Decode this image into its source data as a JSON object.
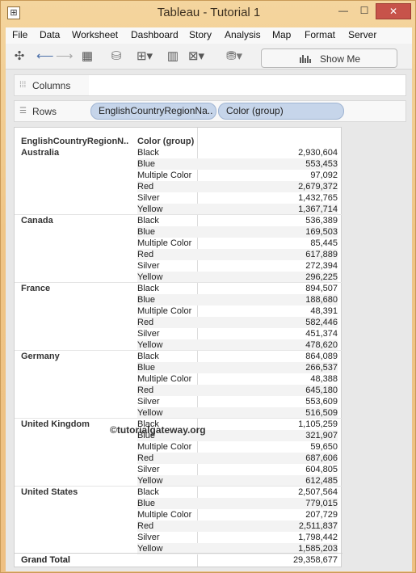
{
  "window": {
    "title": "Tableau - Tutorial 1",
    "min": "—",
    "max": "☐",
    "close": "✕",
    "icon": "⊞"
  },
  "menu": [
    "File",
    "Data",
    "Worksheet",
    "Dashboard",
    "Story",
    "Analysis",
    "Map",
    "Format",
    "Server"
  ],
  "toolbar": {
    "icons": [
      "tableau-logo-icon",
      "back-arrow-icon",
      "forward-arrow-icon",
      "save-icon",
      "new-data-source-icon",
      "new-worksheet-icon",
      "chart-bars-icon",
      "clear-sheet-icon",
      "database-icon"
    ],
    "show_me": "Show Me"
  },
  "shelves": {
    "columns_label": "Columns",
    "rows_label": "Rows",
    "rows_pills": [
      "EnglishCountryRegionNa..",
      "Color (group)"
    ]
  },
  "table": {
    "headers": [
      "EnglishCountryRegionN..",
      "Color (group)"
    ],
    "groups": [
      {
        "country": "Australia",
        "rows": [
          [
            "Black",
            "2,930,604"
          ],
          [
            "Blue",
            "553,453"
          ],
          [
            "Multiple Color",
            "97,092"
          ],
          [
            "Red",
            "2,679,372"
          ],
          [
            "Silver",
            "1,432,765"
          ],
          [
            "Yellow",
            "1,367,714"
          ]
        ]
      },
      {
        "country": "Canada",
        "rows": [
          [
            "Black",
            "536,389"
          ],
          [
            "Blue",
            "169,503"
          ],
          [
            "Multiple Color",
            "85,445"
          ],
          [
            "Red",
            "617,889"
          ],
          [
            "Silver",
            "272,394"
          ],
          [
            "Yellow",
            "296,225"
          ]
        ]
      },
      {
        "country": "France",
        "rows": [
          [
            "Black",
            "894,507"
          ],
          [
            "Blue",
            "188,680"
          ],
          [
            "Multiple Color",
            "48,391"
          ],
          [
            "Red",
            "582,446"
          ],
          [
            "Silver",
            "451,374"
          ],
          [
            "Yellow",
            "478,620"
          ]
        ]
      },
      {
        "country": "Germany",
        "rows": [
          [
            "Black",
            "864,089"
          ],
          [
            "Blue",
            "266,537"
          ],
          [
            "Multiple Color",
            "48,388"
          ],
          [
            "Red",
            "645,180"
          ],
          [
            "Silver",
            "553,609"
          ],
          [
            "Yellow",
            "516,509"
          ]
        ]
      },
      {
        "country": "United Kingdom",
        "rows": [
          [
            "Black",
            "1,105,259"
          ],
          [
            "Blue",
            "321,907"
          ],
          [
            "Multiple Color",
            "59,650"
          ],
          [
            "Red",
            "687,606"
          ],
          [
            "Silver",
            "604,805"
          ],
          [
            "Yellow",
            "612,485"
          ]
        ]
      },
      {
        "country": "United States",
        "rows": [
          [
            "Black",
            "2,507,564"
          ],
          [
            "Blue",
            "779,015"
          ],
          [
            "Multiple Color",
            "207,729"
          ],
          [
            "Red",
            "2,511,837"
          ],
          [
            "Silver",
            "1,798,442"
          ],
          [
            "Yellow",
            "1,585,203"
          ]
        ]
      }
    ],
    "grand_total_label": "Grand Total",
    "grand_total_value": "29,358,677"
  },
  "watermark": "©tutorialgateway.org"
}
